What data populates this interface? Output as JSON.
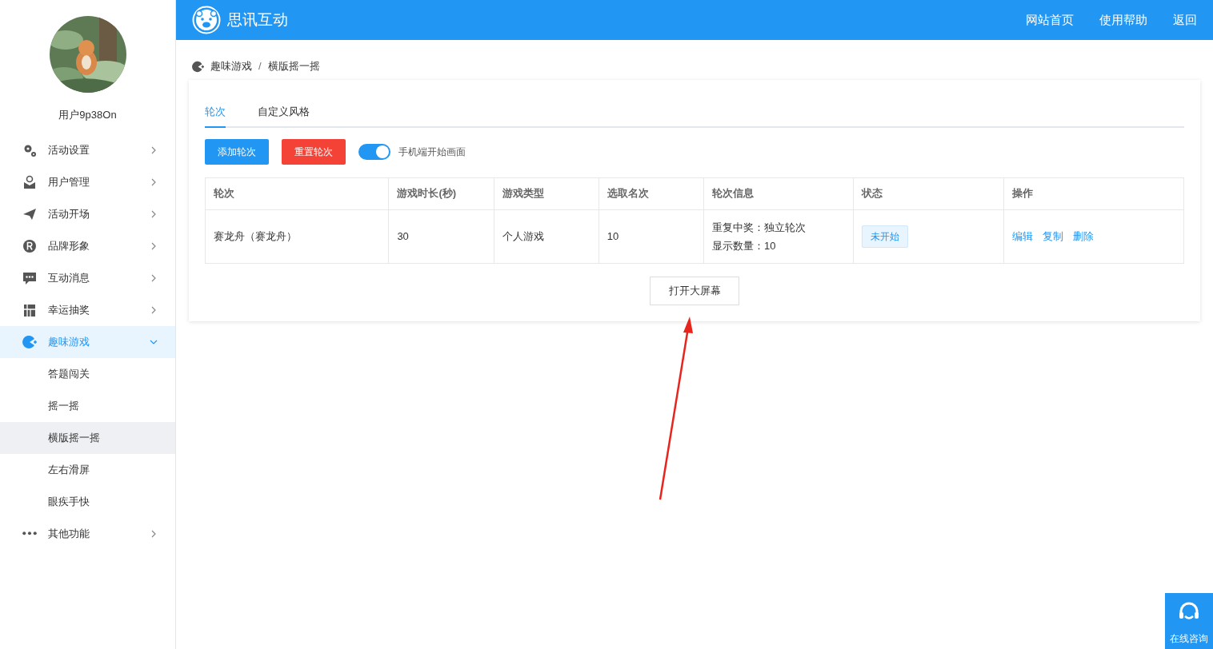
{
  "header": {
    "brand": "思讯互动",
    "links": [
      "网站首页",
      "使用帮助",
      "返回"
    ]
  },
  "sidebar": {
    "user_name": "用户9p38On",
    "items": [
      {
        "label": "活动设置",
        "expanded": false,
        "selected": false
      },
      {
        "label": "用户管理",
        "expanded": false,
        "selected": false
      },
      {
        "label": "活动开场",
        "expanded": false,
        "selected": false
      },
      {
        "label": "品牌形象",
        "expanded": false,
        "selected": false
      },
      {
        "label": "互动消息",
        "expanded": false,
        "selected": false
      },
      {
        "label": "幸运抽奖",
        "expanded": false,
        "selected": false
      },
      {
        "label": "趣味游戏",
        "expanded": true,
        "selected": true,
        "children": [
          {
            "label": "答题闯关",
            "selected": false
          },
          {
            "label": "摇一摇",
            "selected": false
          },
          {
            "label": "横版摇一摇",
            "selected": true
          },
          {
            "label": "左右滑屏",
            "selected": false
          },
          {
            "label": "眼疾手快",
            "selected": false
          }
        ]
      },
      {
        "label": "其他功能",
        "expanded": false,
        "selected": false
      }
    ]
  },
  "breadcrumb": {
    "separator": "/",
    "items": [
      "趣味游戏",
      "横版摇一摇"
    ]
  },
  "tabs": [
    {
      "label": "轮次",
      "selected": true
    },
    {
      "label": "自定义风格",
      "selected": false
    }
  ],
  "toolbar": {
    "buttons": [
      {
        "label": "添加轮次",
        "kind": "primary"
      },
      {
        "label": "重置轮次",
        "kind": "danger"
      }
    ],
    "toggle": {
      "label": "手机端开始画面",
      "on": true
    }
  },
  "table": {
    "columns": [
      "轮次",
      "游戏时长(秒)",
      "游戏类型",
      "选取名次",
      "轮次信息",
      "状态",
      "操作"
    ],
    "rows": [
      {
        "round": "赛龙舟（赛龙舟）",
        "duration": "30",
        "game_type": "个人游戏",
        "pick": "10",
        "info": [
          "重复中奖：独立轮次",
          "显示数量：10"
        ],
        "status": "未开始",
        "actions": [
          "编辑",
          "复制",
          "删除"
        ]
      }
    ]
  },
  "open_screen_button": "打开大屏幕",
  "consult_widget": {
    "label": "在线咨询"
  }
}
